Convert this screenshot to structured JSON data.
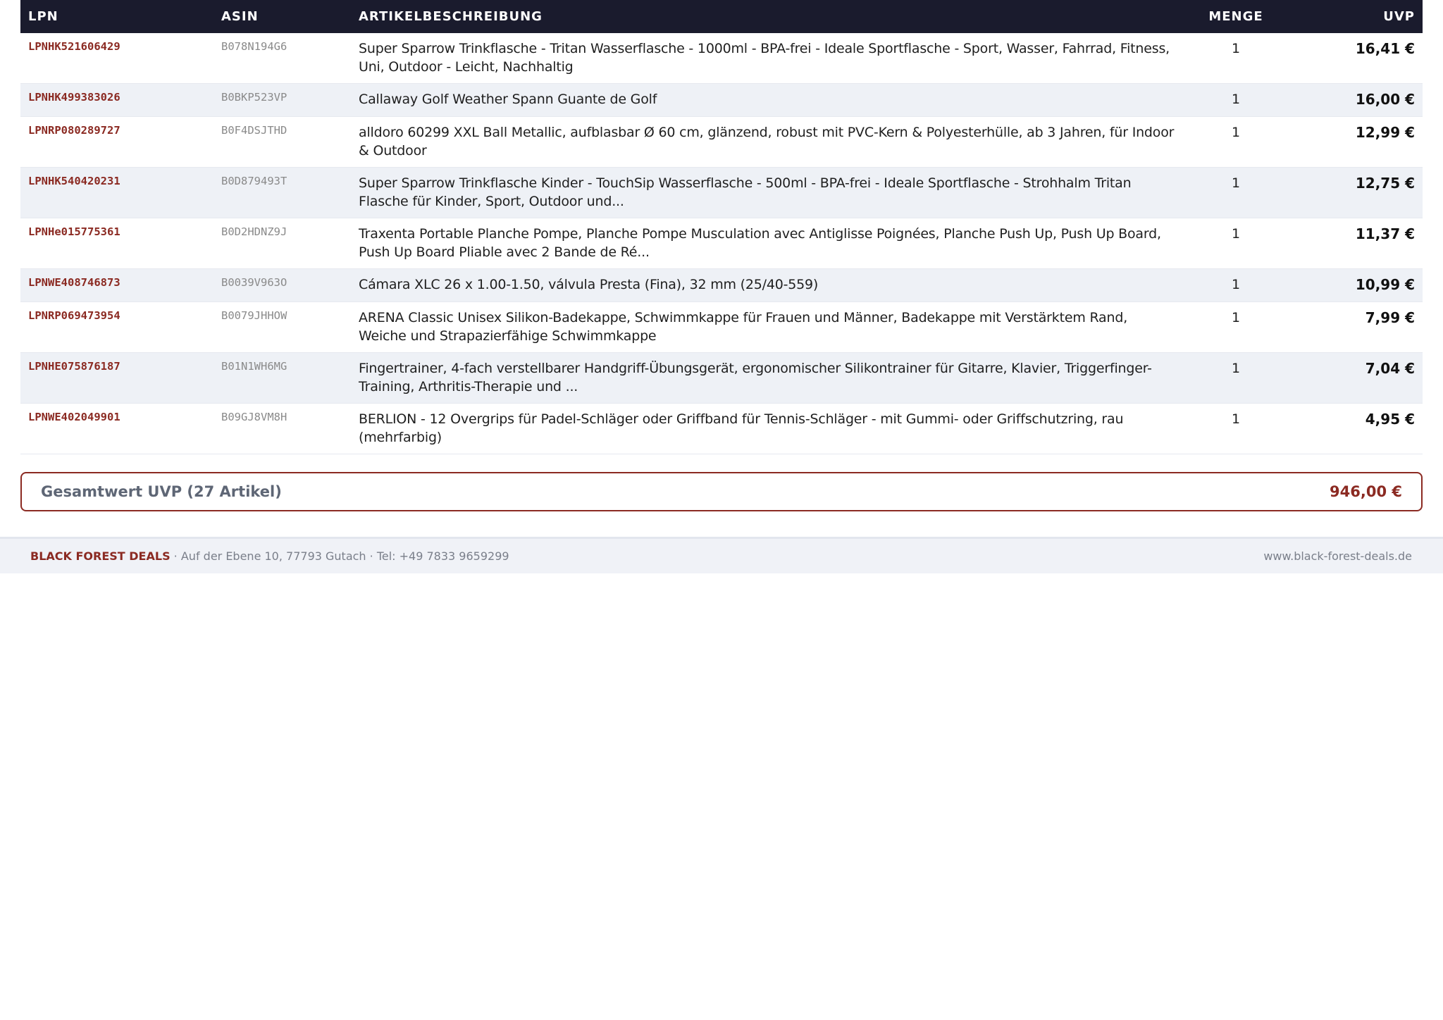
{
  "table": {
    "headers": {
      "lpn": "LPN",
      "asin": "ASIN",
      "description": "ARTIKELBESCHREIBUNG",
      "quantity": "MENGE",
      "uvp": "UVP"
    },
    "rows": [
      {
        "lpn": "LPNHK521606429",
        "asin": "B078N194G6",
        "description": "Super Sparrow Trinkflasche - Tritan Wasserflasche - 1000ml - BPA-frei - Ideale Sportflasche - Sport, Wasser, Fahrrad, Fitness, Uni, Outdoor - Leicht, Nachhaltig",
        "quantity": "1",
        "uvp": "16,41 €"
      },
      {
        "lpn": "LPNHK499383026",
        "asin": "B0BKP523VP",
        "description": "Callaway Golf Weather Spann Guante de Golf",
        "quantity": "1",
        "uvp": "16,00 €"
      },
      {
        "lpn": "LPNRP080289727",
        "asin": "B0F4DSJTHD",
        "description": "alldoro 60299 XXL Ball Metallic, aufblasbar Ø 60 cm, glänzend, robust mit PVC-Kern & Polyesterhülle, ab 3 Jahren, für Indoor & Outdoor",
        "quantity": "1",
        "uvp": "12,99 €"
      },
      {
        "lpn": "LPNHK540420231",
        "asin": "B0D879493T",
        "description": "Super Sparrow Trinkflasche Kinder - TouchSip Wasserflasche - 500ml - BPA-frei - Ideale Sportflasche - Strohhalm Tritan Flasche für Kinder, Sport, Outdoor und...",
        "quantity": "1",
        "uvp": "12,75 €"
      },
      {
        "lpn": "LPNHe015775361",
        "asin": "B0D2HDNZ9J",
        "description": "Traxenta Portable Planche Pompe, Planche Pompe Musculation avec Antiglisse Poignées, Planche Push Up, Push Up Board, Push Up Board Pliable avec 2 Bande de Ré...",
        "quantity": "1",
        "uvp": "11,37 €"
      },
      {
        "lpn": "LPNWE408746873",
        "asin": "B0039V963O",
        "description": "Cámara XLC 26 x 1.00-1.50, válvula Presta (Fina), 32 mm (25/40-559)",
        "quantity": "1",
        "uvp": "10,99 €"
      },
      {
        "lpn": "LPNRP069473954",
        "asin": "B0079JHHOW",
        "description": "ARENA Classic Unisex Silikon-Badekappe, Schwimmkappe für Frauen und Männer, Badekappe mit Verstärktem Rand, Weiche und Strapazierfähige Schwimmkappe",
        "quantity": "1",
        "uvp": "7,99 €"
      },
      {
        "lpn": "LPNHE075876187",
        "asin": "B01N1WH6MG",
        "description": "Fingertrainer, 4-fach verstellbarer Handgriff-Übungsgerät, ergonomischer Silikontrainer für Gitarre, Klavier, Triggerfinger-Training, Arthritis-Therapie und ...",
        "quantity": "1",
        "uvp": "7,04 €"
      },
      {
        "lpn": "LPNWE402049901",
        "asin": "B09GJ8VM8H",
        "description": "BERLION - 12 Overgrips für Padel-Schläger oder Griffband für Tennis-Schläger - mit Gummi- oder Griffschutzring, rau (mehrfarbig)",
        "quantity": "1",
        "uvp": "4,95 €"
      }
    ]
  },
  "total": {
    "label": "Gesamtwert UVP (27 Artikel)",
    "value": "946,00 €"
  },
  "footer": {
    "brand": "BLACK FOREST DEALS",
    "address": " · Auf der Ebene 10, 77793 Gutach · Tel: +49 7833 9659299",
    "website": "www.black-forest-deals.de"
  },
  "colors": {
    "header_bg": "#1a1b2d",
    "accent": "#8b2a22",
    "row_alt": "#eef1f6",
    "footer_bg": "#f0f2f7"
  }
}
